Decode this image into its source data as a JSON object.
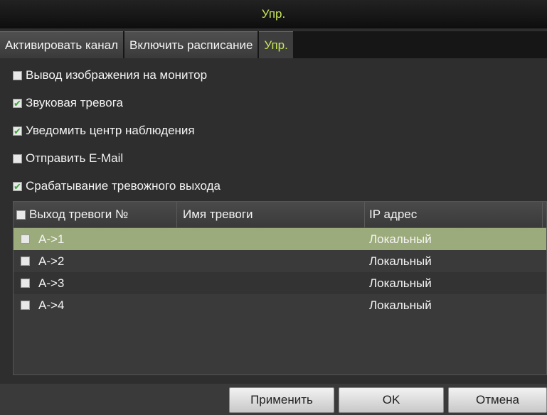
{
  "window": {
    "title": "Упр."
  },
  "tabs": [
    {
      "label": "Активировать канал",
      "active": false
    },
    {
      "label": "Включить расписание",
      "active": false
    },
    {
      "label": "Упр.",
      "active": true
    }
  ],
  "options": [
    {
      "label": "Вывод изображения на монитор",
      "checked": false
    },
    {
      "label": "Звуковая тревога",
      "checked": true
    },
    {
      "label": "Уведомить центр наблюдения",
      "checked": true
    },
    {
      "label": "Отправить E-Mail",
      "checked": false
    },
    {
      "label": "Срабатывание тревожного выхода",
      "checked": true
    }
  ],
  "table": {
    "columns": [
      "Выход тревоги №",
      "Имя тревоги",
      "IP адрес"
    ],
    "rows": [
      {
        "output": "A->1",
        "name": "",
        "ip": "Локальный",
        "selected": true
      },
      {
        "output": "A->2",
        "name": "",
        "ip": "Локальный",
        "selected": false
      },
      {
        "output": "A->3",
        "name": "",
        "ip": "Локальный",
        "selected": false
      },
      {
        "output": "A->4",
        "name": "",
        "ip": "Локальный",
        "selected": false
      }
    ]
  },
  "buttons": {
    "apply": "Применить",
    "ok": "OK",
    "cancel": "Отмена"
  },
  "colors": {
    "accent": "#c6e55b",
    "selected_row": "#9cab7b",
    "check": "#3aa836"
  }
}
